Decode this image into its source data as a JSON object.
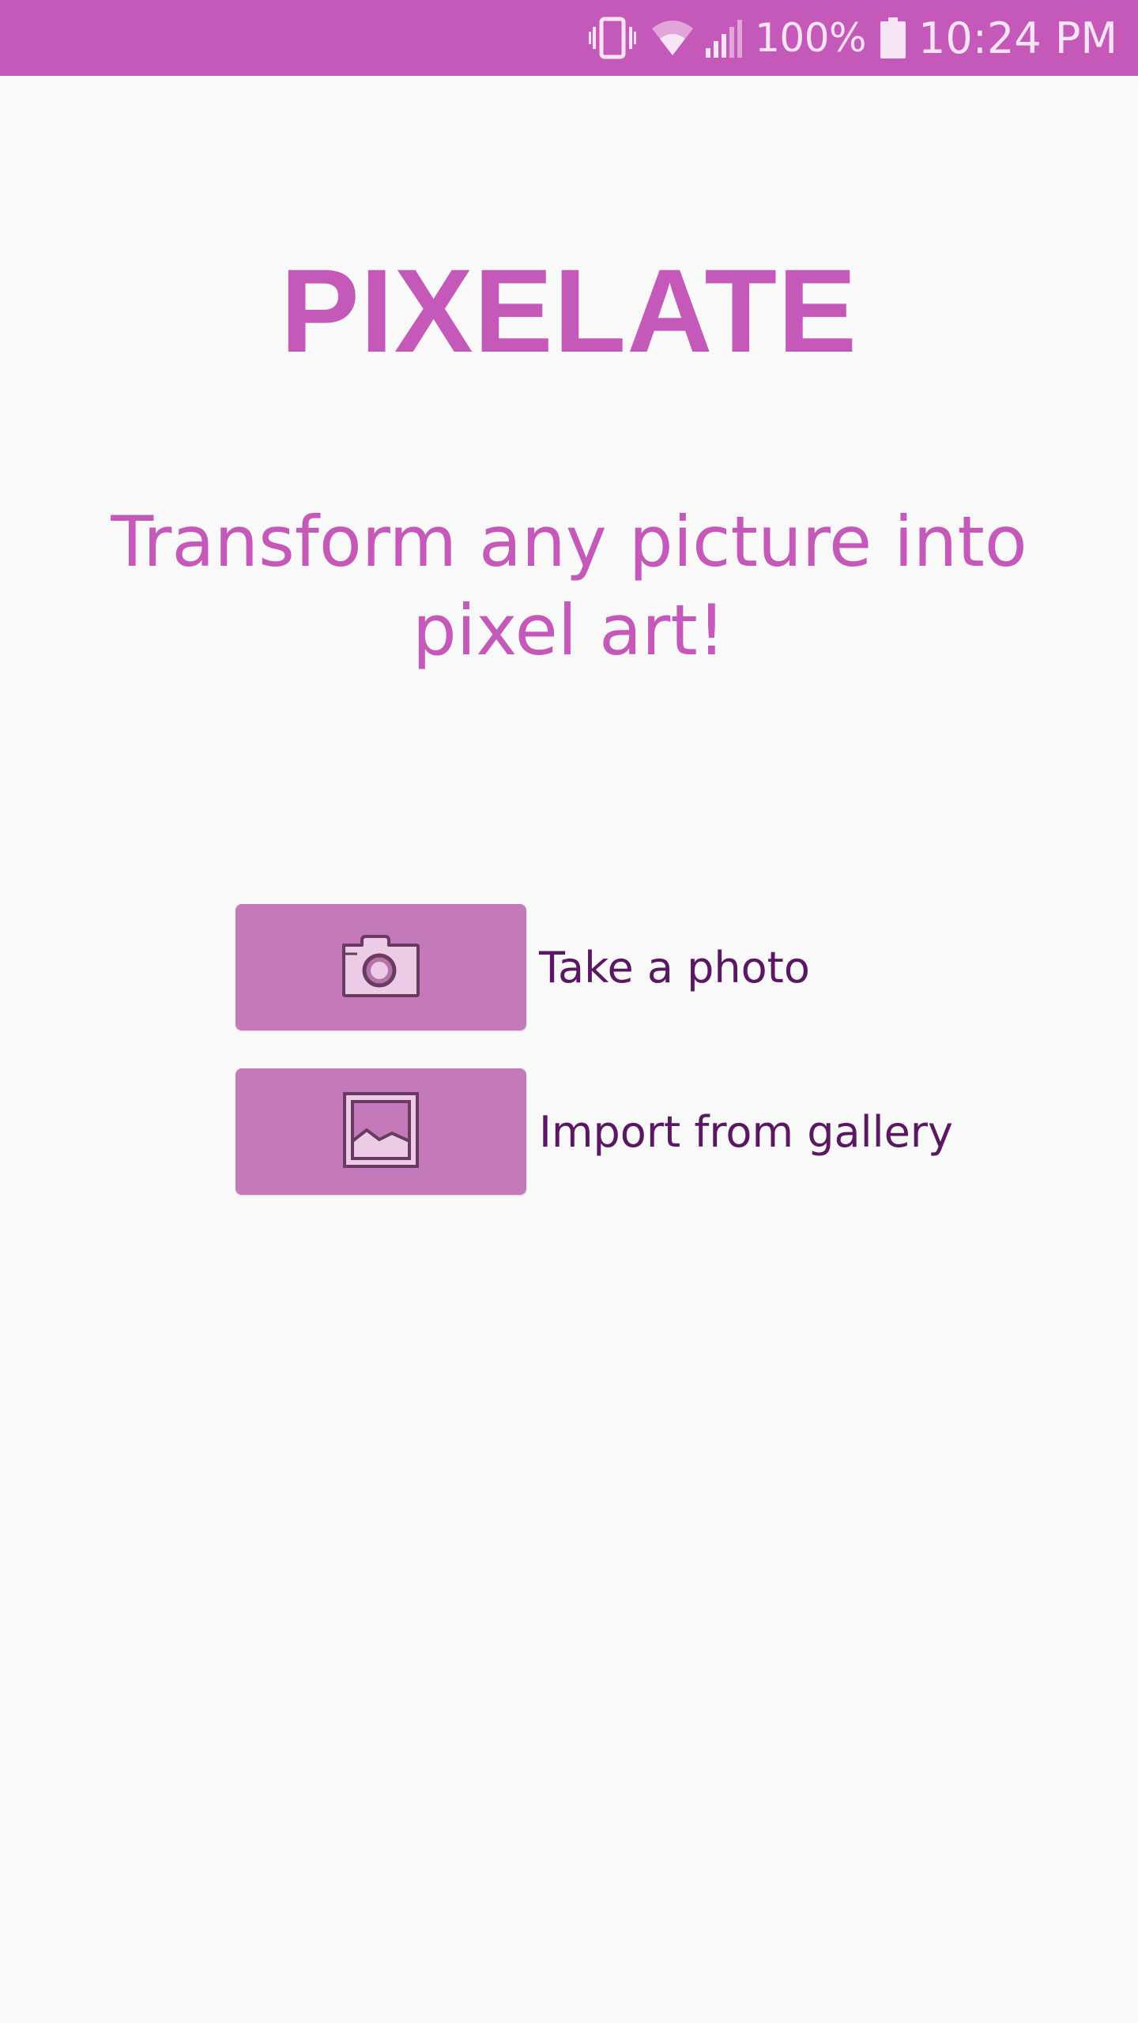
{
  "status_bar": {
    "battery_percent": "100%",
    "time": "10:24 PM",
    "icons": [
      "vibrate-icon",
      "wifi-icon",
      "signal-icon",
      "battery-icon"
    ]
  },
  "app": {
    "title": "PIXELATE",
    "tagline_line1": "Transform any picture into",
    "tagline_line2": "pixel art!"
  },
  "actions": [
    {
      "label": "Take a photo",
      "icon": "camera-icon"
    },
    {
      "label": "Import from gallery",
      "icon": "image-icon"
    }
  ],
  "colors": {
    "primary": "#c559b9",
    "button_background": "#c47aba",
    "label_text": "#5a1862",
    "background": "#f9f9f9"
  }
}
